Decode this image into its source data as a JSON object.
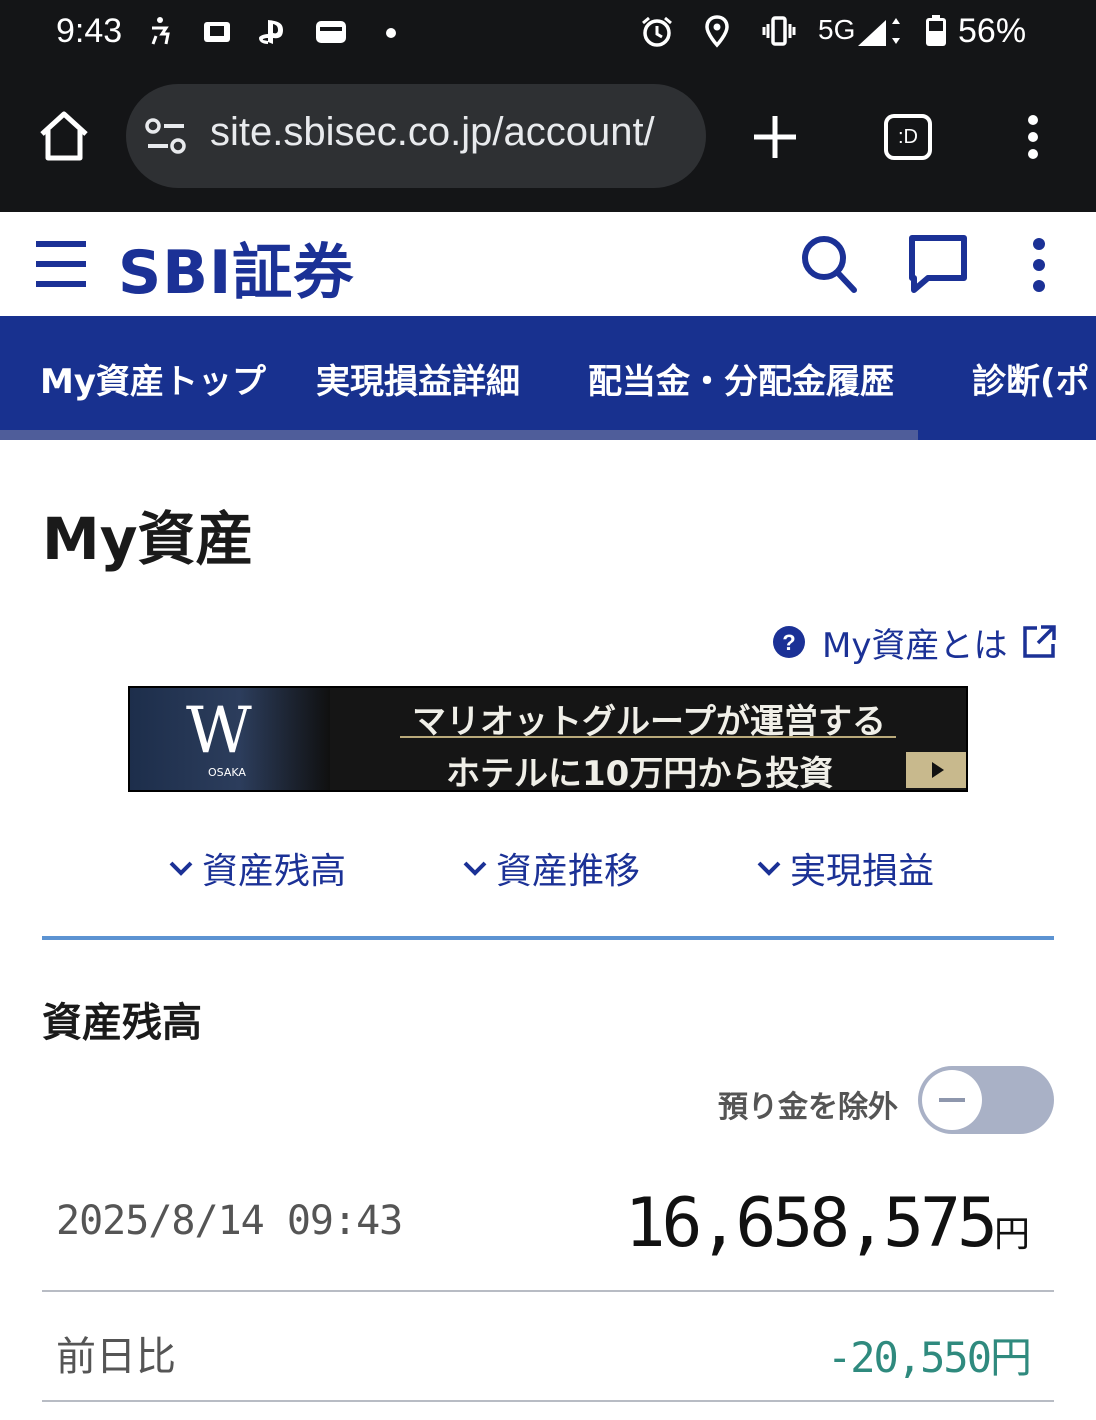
{
  "status_bar": {
    "time": "9:43",
    "network": "5G",
    "battery": "56%",
    "icons": [
      "accessibility-icon",
      "app-notification-icon",
      "playstation-icon",
      "wallet-icon",
      "dot-icon",
      "alarm-icon",
      "location-icon",
      "vibrate-icon",
      "signal-icon",
      "battery-icon"
    ]
  },
  "browser": {
    "url": "site.sbisec.co.jp/account/",
    "tab_badge": ":D"
  },
  "site": {
    "logo": "SBI証券",
    "brand_color": "#1b3196",
    "nav_color": "#18318f"
  },
  "nav_tabs": [
    {
      "label": "My資産トップ",
      "active": true
    },
    {
      "label": "実現損益詳細"
    },
    {
      "label": "配当金・分配金履歴"
    },
    {
      "label": "診断(ポ"
    }
  ],
  "page": {
    "title": "My資産",
    "help_link": "My資産とは"
  },
  "banner": {
    "brand": "W",
    "brand_sub": "OSAKA",
    "line1": "マリオットグループが運営する",
    "line2": "ホテルに10万円から投資"
  },
  "anchors": [
    {
      "label": "資産残高"
    },
    {
      "label": "資産推移"
    },
    {
      "label": "実現損益"
    }
  ],
  "balance": {
    "section_title": "資産残高",
    "toggle_label": "預り金を除外",
    "toggle_on": false,
    "timestamp": "2025/8/14 09:43",
    "amount": "16,658,575",
    "unit": "円",
    "diff_label": "前日比",
    "diff_value": "-20,550円",
    "diff_color": "#2f8a7e"
  }
}
